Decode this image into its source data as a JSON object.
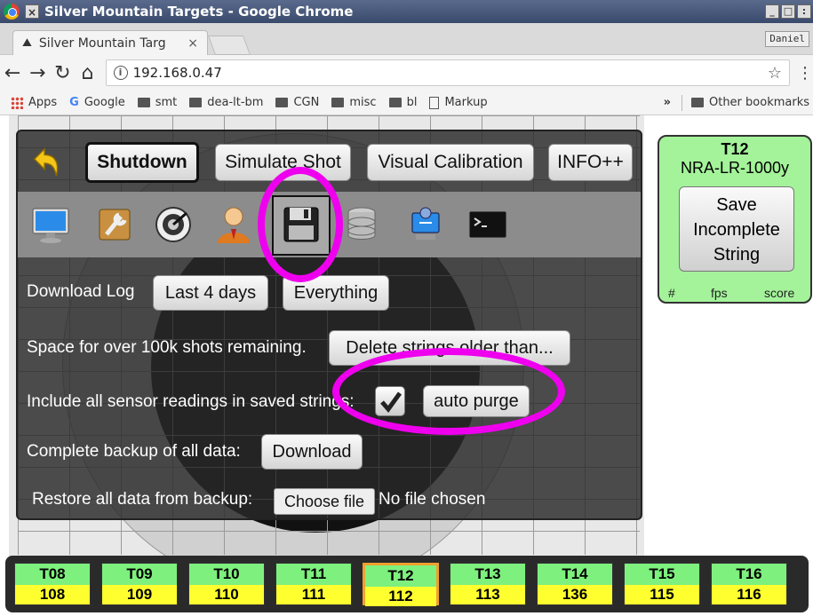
{
  "window": {
    "title": "Silver Mountain Targets - Google Chrome",
    "close": "×",
    "buttons": [
      "_",
      "□",
      ":"
    ]
  },
  "tab": {
    "label": "Silver Mountain Targ",
    "close": "×"
  },
  "profile": "Daniel",
  "address": {
    "url": "192.168.0.47"
  },
  "bookmarks": {
    "items": [
      "Apps",
      "Google",
      "smt",
      "dea-lt-bm",
      "CGN",
      "misc",
      "bl",
      "Markup"
    ],
    "overflow": "»",
    "other": "Other bookmarks"
  },
  "toolbar": {
    "shutdown": "Shutdown",
    "simulate": "Simulate Shot",
    "visual": "Visual Calibration",
    "info": "INFO++"
  },
  "icons": [
    "monitor-icon",
    "settings-wrench-icon",
    "target-icon",
    "user-icon",
    "save-floppy-icon",
    "database-icon",
    "network-icon",
    "terminal-icon"
  ],
  "settings": {
    "download_log_label": "Download Log",
    "last4": "Last 4 days",
    "everything": "Everything",
    "space_label": "Space for over 100k shots remaining.",
    "delete_older": "Delete strings older than...",
    "include_label": "Include all sensor readings in saved strings:",
    "include_checked": true,
    "auto_purge": "auto purge",
    "backup_label": "Complete backup of all data:",
    "download": "Download",
    "restore_label": "Restore all data from backup:",
    "choose_file": "Choose file",
    "no_file": "No file chosen"
  },
  "card": {
    "title": "T12",
    "subtitle": "NRA-LR-1000y",
    "save_line1": "Save",
    "save_line2": "Incomplete",
    "save_line3": "String",
    "col_hash": "#",
    "col_fps": "fps",
    "col_score": "score"
  },
  "lanes": [
    {
      "t": "T08",
      "n": "108"
    },
    {
      "t": "T09",
      "n": "109"
    },
    {
      "t": "T10",
      "n": "110"
    },
    {
      "t": "T11",
      "n": "111"
    },
    {
      "t": "T12",
      "n": "112",
      "active": true
    },
    {
      "t": "T13",
      "n": "113"
    },
    {
      "t": "T14",
      "n": "136"
    },
    {
      "t": "T15",
      "n": "115"
    },
    {
      "t": "T16",
      "n": "116"
    }
  ],
  "colors": {
    "annotation": "#ee00ee",
    "card_bg": "#a4f39a",
    "lane_top": "#7ef07e",
    "lane_bottom": "#ffff30",
    "active_lane_border": "#f0a030"
  }
}
